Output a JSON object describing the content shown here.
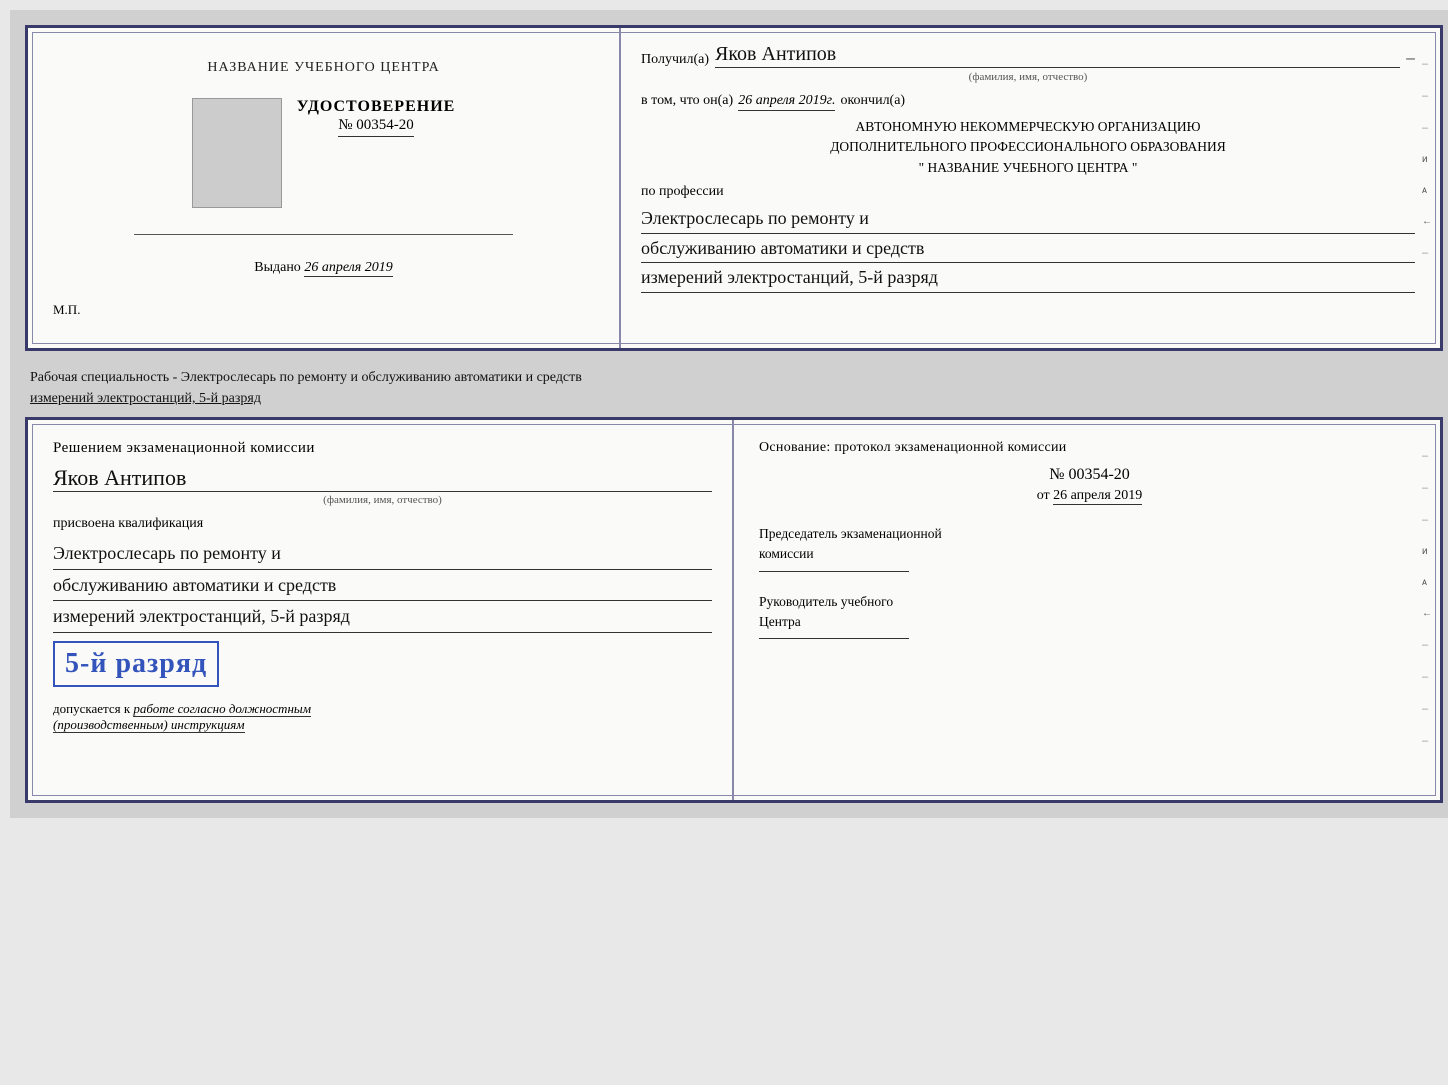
{
  "top_cert": {
    "left": {
      "org_name": "НАЗВАНИЕ УЧЕБНОГО ЦЕНТРА",
      "udost_title": "УДОСТОВЕРЕНИЕ",
      "number": "№ 00354-20",
      "issued_label": "Выдано",
      "issued_date": "26 апреля 2019",
      "mp_label": "М.П."
    },
    "right": {
      "recipient_label": "Получил(а)",
      "recipient_name": "Яков Антипов",
      "fio_hint": "(фамилия, имя, отчество)",
      "date_prefix": "в том, что он(а)",
      "date_value": "26 апреля 2019г.",
      "date_suffix": "окончил(а)",
      "org_line1": "АВТОНОМНУЮ НЕКОММЕРЧЕСКУЮ ОРГАНИЗАЦИЮ",
      "org_line2": "ДОПОЛНИТЕЛЬНОГО ПРОФЕССИОНАЛЬНОГО ОБРАЗОВАНИЯ",
      "org_line3": "\"    НАЗВАНИЕ УЧЕБНОГО ЦЕНТРА    \"",
      "profession_label": "по профессии",
      "profession_line1": "Электрослесарь по ремонту и",
      "profession_line2": "обслуживанию автоматики и средств",
      "profession_line3": "измерений электростанций, 5-й разряд"
    }
  },
  "middle": {
    "text": "Рабочая специальность - Электрослесарь по ремонту и обслуживанию автоматики и средств",
    "text2": "измерений электростанций, 5-й разряд"
  },
  "bottom_cert": {
    "left": {
      "komissia_title": "Решением экзаменационной комиссии",
      "person_name": "Яков Антипов",
      "fio_hint": "(фамилия, имя, отчество)",
      "kvalif_label": "присвоена квалификация",
      "kvalif_line1": "Электрослесарь по ремонту и",
      "kvalif_line2": "обслуживанию автоматики и средств",
      "kvalif_line3": "измерений электростанций, 5-й разряд",
      "razryad_label": "5-й разряд",
      "dopusk_label": "допускается к",
      "dopusk_text": "работе согласно должностным",
      "dopusk_text2": "(производственным) инструкциям"
    },
    "right": {
      "osnov_label": "Основание: протокол экзаменационной комиссии",
      "protocol_number": "№  00354-20",
      "protocol_date_prefix": "от",
      "protocol_date": "26 апреля 2019",
      "chairman_title": "Председатель экзаменационной",
      "chairman_title2": "комиссии",
      "rukovoditel_title": "Руководитель учебного",
      "rukovoditel_title2": "Центра"
    }
  }
}
